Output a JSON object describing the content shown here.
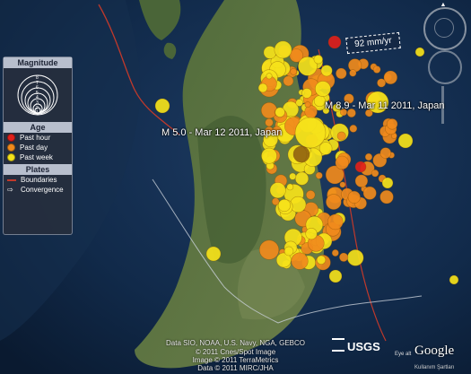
{
  "legend": {
    "magnitude_title": "Magnitude",
    "magnitude_scale": [
      "8",
      "7",
      "6",
      "5",
      "4",
      "3",
      "2",
      "1"
    ],
    "age_title": "Age",
    "age_items": [
      {
        "label": "Past hour",
        "color": "#e0201b"
      },
      {
        "label": "Past day",
        "color": "#f08a1c"
      },
      {
        "label": "Past week",
        "color": "#f5e21a"
      }
    ],
    "plates_title": "Plates",
    "plates_items": [
      {
        "label": "Boundaries",
        "color": "#c0392b"
      },
      {
        "label": "Convergence",
        "icon": "convergence-arrow-icon"
      }
    ]
  },
  "labels": {
    "quake_main": "M 8.9 - Mar 11 2011, Japan",
    "quake_second": "M 5.0 - Mar 12 2011, Japan",
    "speed": "92 mm/yr"
  },
  "credits": {
    "line1": "Data SIO, NOAA, U.S. Navy, NGA, GEBCO",
    "line2": "© 2011 Cnes/Spot Image",
    "line3": "Image © 2011 TerraMetrics",
    "line4": "Data © 2011 MIRC/JHA"
  },
  "brand": {
    "usgs": "USGS",
    "google": "Google",
    "eye_alt": "Eye alt",
    "terms": "Kullanım Şartları"
  },
  "colors": {
    "past_hour": "#e0201b",
    "past_day": "#f08a1c",
    "past_week": "#f5e21a",
    "plate_boundary": "#c0392b"
  }
}
